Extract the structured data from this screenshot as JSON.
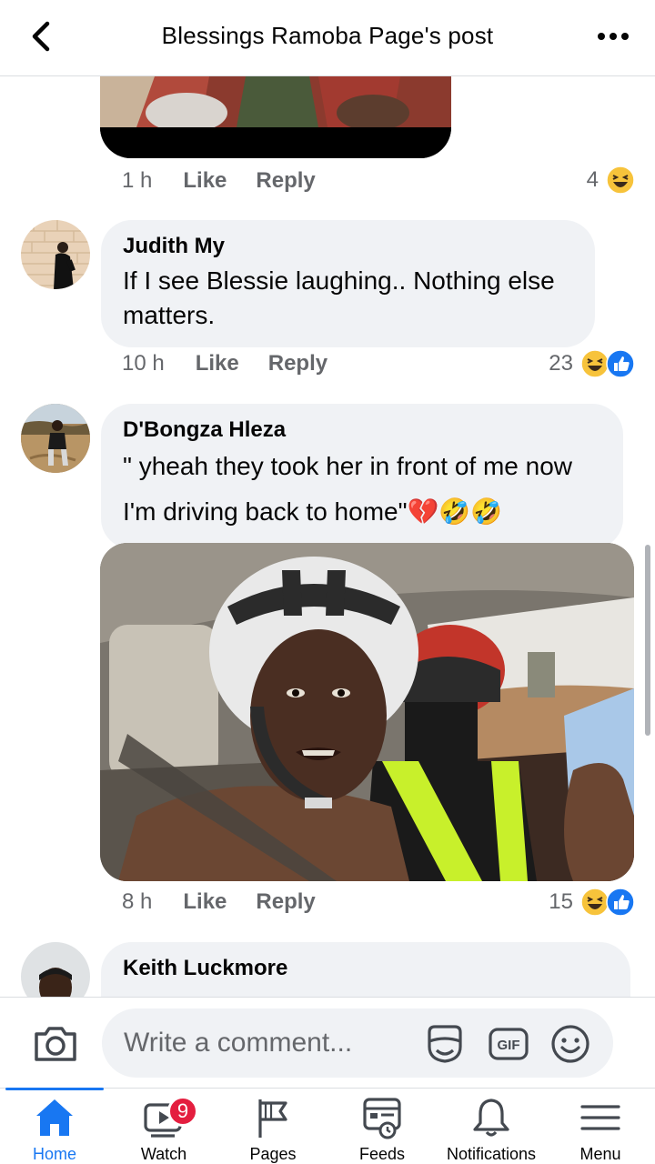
{
  "header": {
    "title": "Blessings Ramoba Page's post"
  },
  "previous_comment": {
    "time": "1 h",
    "like_label": "Like",
    "reply_label": "Reply",
    "reaction_count": "4",
    "reaction_icons": [
      "laughing-emoji-icon"
    ]
  },
  "comments": [
    {
      "author": "Judith My",
      "text": "If I see Blessie laughing.. Nothing else matters.",
      "time": "10 h",
      "like_label": "Like",
      "reply_label": "Reply",
      "reaction_count": "23",
      "reaction_icons": [
        "laughing-emoji-icon",
        "like-thumb-icon"
      ]
    },
    {
      "author": "D'Bongza Hleza",
      "text": "\" yheah they took her in front of me now I'm driving back to home\"💔🤣🤣",
      "time": "8 h",
      "like_label": "Like",
      "reply_label": "Reply",
      "reaction_count": "15",
      "reaction_icons": [
        "laughing-emoji-icon",
        "like-thumb-icon"
      ]
    },
    {
      "author": "Keith Luckmore"
    }
  ],
  "composer": {
    "placeholder": "Write a comment..."
  },
  "tabs": [
    {
      "label": "Home",
      "icon": "home-icon",
      "active": true
    },
    {
      "label": "Watch",
      "icon": "watch-icon",
      "badge": "9"
    },
    {
      "label": "Pages",
      "icon": "pages-flag-icon"
    },
    {
      "label": "Feeds",
      "icon": "feeds-icon"
    },
    {
      "label": "Notifications",
      "icon": "bell-icon"
    },
    {
      "label": "Menu",
      "icon": "menu-icon"
    }
  ],
  "colors": {
    "accent": "#1877f2",
    "bubble": "#f0f2f5",
    "secondary_text": "#65676b",
    "badge": "#e41e3f"
  }
}
